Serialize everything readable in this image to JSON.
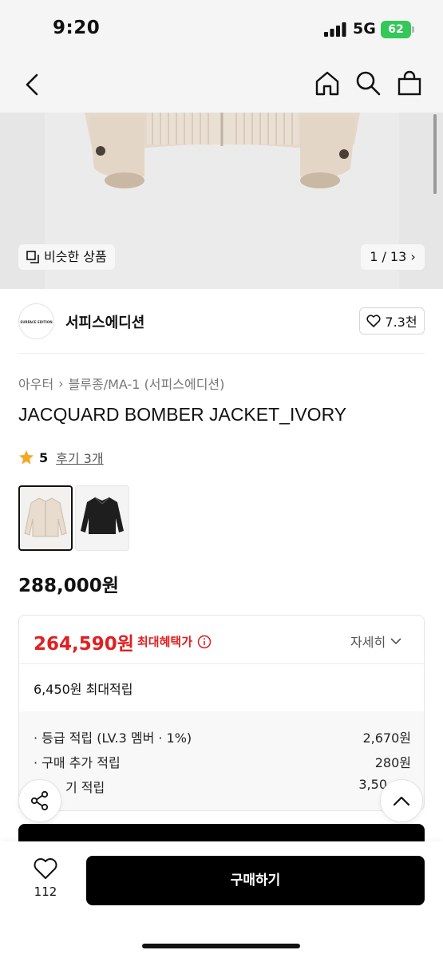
{
  "status_bar": {
    "time": "9:20",
    "network": "5G",
    "battery": "62"
  },
  "gallery": {
    "similar_label": "비슷한 상품",
    "counter": "1 / 13"
  },
  "brand": {
    "logo_text": "SURFACE EDITION",
    "name": "서피스에디션",
    "likes": "7.3천"
  },
  "breadcrumb": {
    "category": "아우터",
    "subcategory": "블루종/MA-1 (서피스에디션)"
  },
  "product": {
    "title": "JACQUARD BOMBER JACKET_IVORY",
    "rating": "5",
    "reviews": "후기 3개",
    "price": "288,000원"
  },
  "benefit": {
    "sale_price": "264,590원",
    "sale_label": "최대혜택가",
    "detail_label": "자세히",
    "max_points": "6,450원 최대적립",
    "rows": [
      {
        "label": "· 등급 적립 (LV.3 멤버 · 1%)",
        "value": "2,670원"
      },
      {
        "label": "· 구매 추가 적립",
        "value": "280원"
      },
      {
        "label": "기 적립",
        "value": "3,50"
      }
    ]
  },
  "bottom_bar": {
    "fav_count": "112",
    "buy_label": "구매하기"
  },
  "colors": {
    "sale": "#e02020",
    "star": "#f5a623",
    "battery": "#34c759"
  }
}
